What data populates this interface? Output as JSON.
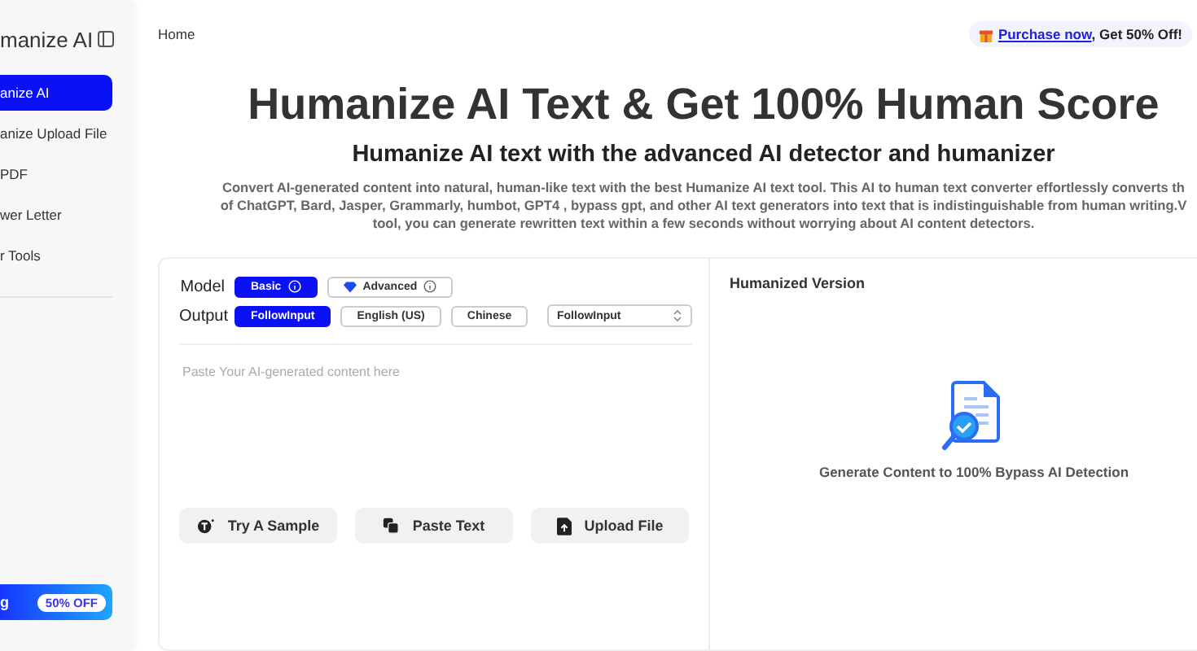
{
  "sidebar": {
    "logo": "manize AI",
    "items": [
      {
        "label": "anize AI",
        "selected": true
      },
      {
        "label": "anize Upload File",
        "selected": false
      },
      {
        "label": "PDF",
        "selected": false
      },
      {
        "label": "wer Letter",
        "selected": false
      },
      {
        "label": "r Tools",
        "selected": false
      }
    ],
    "promo": {
      "label": "g",
      "badge": "50% OFF"
    }
  },
  "breadcrumb": "Home",
  "purchase": {
    "link": "Purchase now",
    "text": ", Get 50% Off!"
  },
  "title": "Humanize AI Text & Get 100% Human Score",
  "subtitle": "Humanize AI text with the advanced AI detector and humanizer",
  "description": [
    "Convert AI-generated content into natural, human-like text with the best Humanize AI text tool. This AI to human text converter effortlessly converts th",
    "of ChatGPT, Bard, Jasper, Grammarly, humbot, GPT4 , bypass gpt, and other AI text generators into text that is indistinguishable from human writing.V",
    "tool, you can generate rewritten text within a few seconds without worrying about AI content detectors."
  ],
  "model": {
    "label": "Model",
    "options": [
      {
        "label": "Basic",
        "selected": true
      },
      {
        "label": "Advanced",
        "selected": false
      }
    ]
  },
  "output": {
    "label": "Output",
    "options": [
      {
        "label": "FollowInput",
        "selected": true
      },
      {
        "label": "English (US)",
        "selected": false
      },
      {
        "label": "Chinese",
        "selected": false
      }
    ],
    "select": "FollowInput"
  },
  "input": {
    "placeholder": "Paste Your AI-generated content here"
  },
  "actions": [
    {
      "kind": "sample",
      "label": "Try A Sample"
    },
    {
      "kind": "paste",
      "label": "Paste Text"
    },
    {
      "kind": "upload",
      "label": "Upload File"
    }
  ],
  "result": {
    "title": "Humanized Version",
    "empty": "Generate Content to 100% Bypass AI Detection"
  }
}
